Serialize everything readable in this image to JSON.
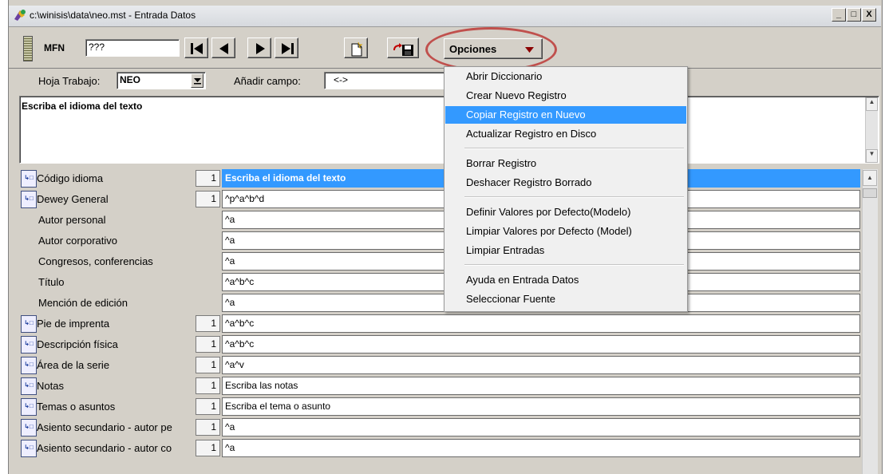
{
  "window": {
    "title": "c:\\winisis\\data\\neo.mst - Entrada Datos",
    "controls": {
      "minimize": "_",
      "maximize": "□",
      "close": "X"
    }
  },
  "toolbar": {
    "mfn_label": "MFN",
    "mfn_value": "???",
    "options_label": "Opciones"
  },
  "worksheet": {
    "label": "Hoja Trabajo:",
    "value": "NEO",
    "add_field_label": "Añadir campo:",
    "add_field_value": "<->"
  },
  "prompt": {
    "text": "Escriba el idioma del texto"
  },
  "menu": {
    "items": [
      {
        "label": "Abrir Diccionario",
        "highlighted": false
      },
      {
        "label": "Crear Nuevo Registro",
        "highlighted": false
      },
      {
        "label": "Copiar Registro en Nuevo",
        "highlighted": true
      },
      {
        "label": "Actualizar Registro en Disco",
        "highlighted": false
      },
      {
        "label": "Borrar Registro",
        "highlighted": false
      },
      {
        "label": "Deshacer Registro Borrado",
        "highlighted": false
      },
      {
        "label": "Definir Valores por Defecto(Modelo)",
        "highlighted": false
      },
      {
        "label": "Limpiar Valores por Defecto (Model)",
        "highlighted": false
      },
      {
        "label": "Limpiar Entradas",
        "highlighted": false
      },
      {
        "label": "Ayuda en Entrada Datos",
        "highlighted": false
      },
      {
        "label": "Seleccionar Fuente",
        "highlighted": false
      }
    ]
  },
  "fields": [
    {
      "name": "Código idioma",
      "repeatable": true,
      "occ": "1",
      "value": "Escriba el idioma del texto",
      "active": true
    },
    {
      "name": "Dewey General",
      "repeatable": true,
      "occ": "1",
      "value": "^p^a^b^d",
      "active": false
    },
    {
      "name": "Autor personal",
      "repeatable": false,
      "occ": "",
      "value": "^a",
      "active": false
    },
    {
      "name": "Autor corporativo",
      "repeatable": false,
      "occ": "",
      "value": "^a",
      "active": false
    },
    {
      "name": "Congresos, conferencias",
      "repeatable": false,
      "occ": "",
      "value": "^a",
      "active": false
    },
    {
      "name": "Título",
      "repeatable": false,
      "occ": "",
      "value": "^a^b^c",
      "active": false
    },
    {
      "name": "Mención de edición",
      "repeatable": false,
      "occ": "",
      "value": "^a",
      "active": false
    },
    {
      "name": "Pie de imprenta",
      "repeatable": true,
      "occ": "1",
      "value": "^a^b^c",
      "active": false
    },
    {
      "name": "Descripción física",
      "repeatable": true,
      "occ": "1",
      "value": "^a^b^c",
      "active": false
    },
    {
      "name": "Área de la serie",
      "repeatable": true,
      "occ": "1",
      "value": "^a^v",
      "active": false
    },
    {
      "name": "Notas",
      "repeatable": true,
      "occ": "1",
      "value": "Escriba las notas",
      "active": false
    },
    {
      "name": "Temas o asuntos",
      "repeatable": true,
      "occ": "1",
      "value": "Escriba el tema o asunto",
      "active": false
    },
    {
      "name": "Asiento secundario - autor pe",
      "repeatable": true,
      "occ": "1",
      "value": "^a",
      "active": false
    },
    {
      "name": "Asiento secundario - autor co",
      "repeatable": true,
      "occ": "1",
      "value": "^a",
      "active": false
    }
  ],
  "colors": {
    "selection": "#3399ff",
    "annotation_ring": "#c0504d",
    "window_face": "#d4d0c8"
  }
}
